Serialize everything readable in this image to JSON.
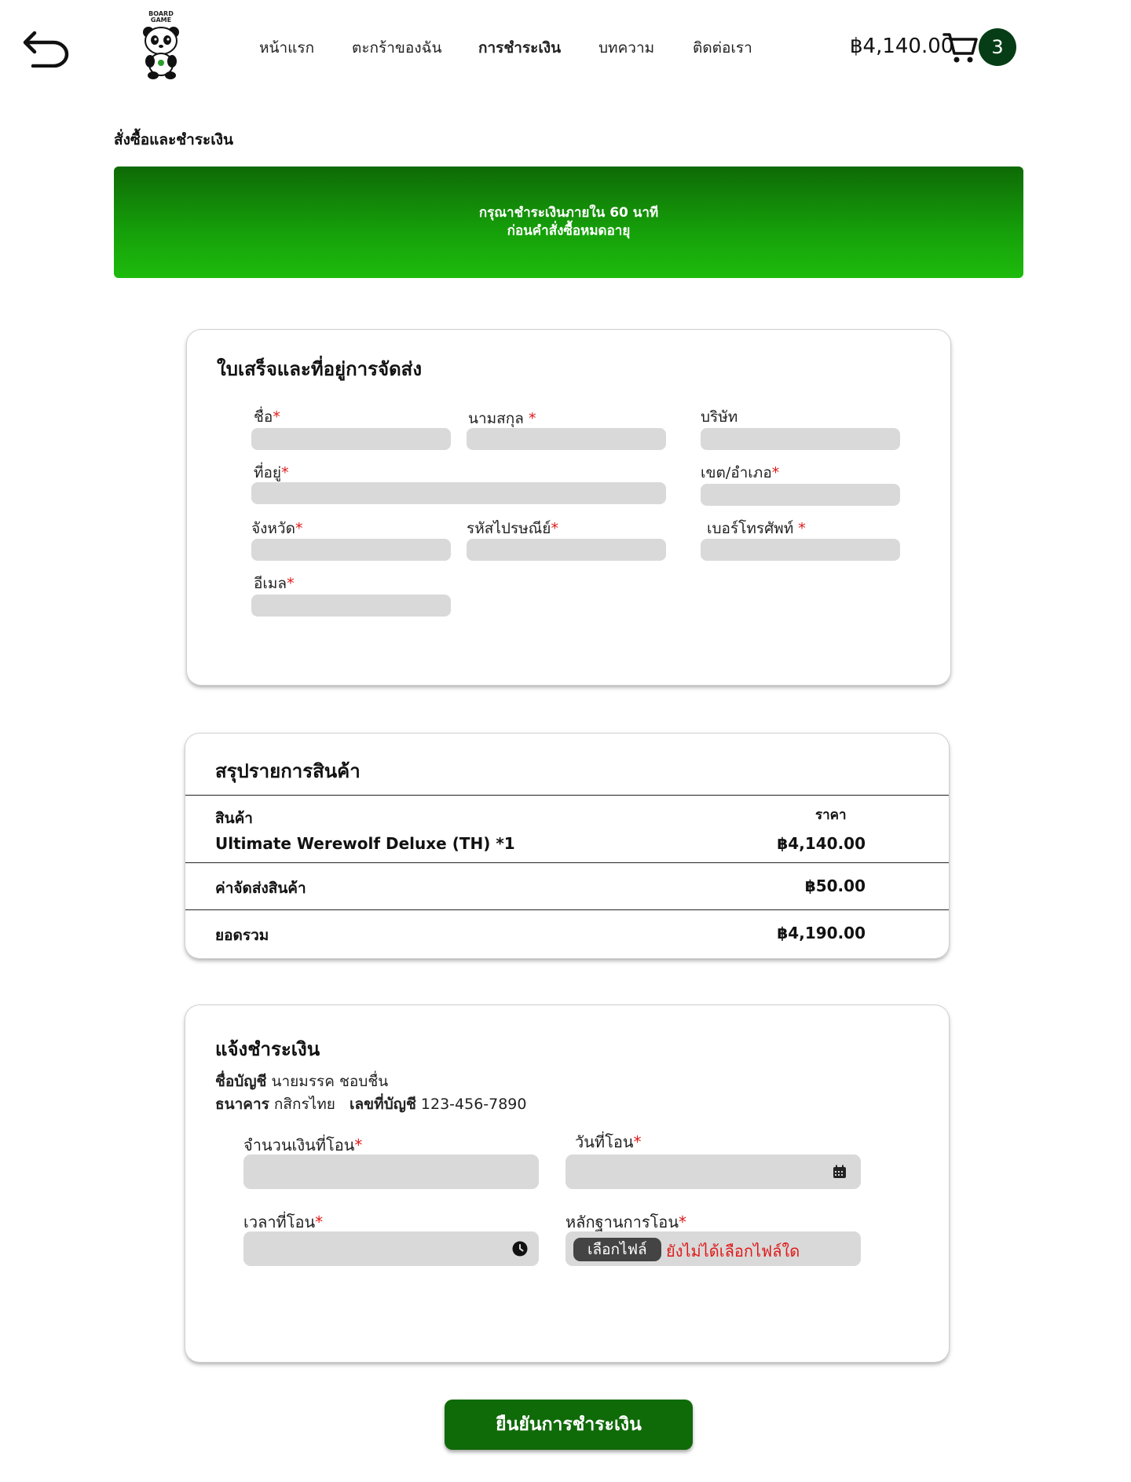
{
  "header": {
    "nav": [
      {
        "label": "หน้าแรก",
        "active": false
      },
      {
        "label": "ตะกร้าของฉัน",
        "active": false
      },
      {
        "label": "การชำระเงิน",
        "active": true
      },
      {
        "label": "บทความ",
        "active": false
      },
      {
        "label": "ติดต่อเรา",
        "active": false
      }
    ],
    "logo_text_1": "BOARD",
    "logo_text_2": "GAME",
    "cart_total": "฿4,140.00",
    "cart_count": "3"
  },
  "page_heading": "สั่งซื้อและชำระเงิน",
  "banner": {
    "line1": "กรุณาชำระเงินภายใน 60 นาที",
    "line2": "ก่อนคำสั่งซื้อหมดอายุ"
  },
  "billing": {
    "title": "ใบเสร็จและที่อยู่การจัดส่ง",
    "first_name": "ชื่อ",
    "last_name": "นามสกุล",
    "company": "บริษัท",
    "address": "ที่อยู่",
    "district": "เขต/อำเภอ",
    "province": "จังหวัด",
    "postal_code": "รหัสไปรษณีย์",
    "phone": "เบอร์โทรศัพท์",
    "email": "อีเมล",
    "required_mark": "*"
  },
  "summary": {
    "title": "สรุปรายการสินค้า",
    "col_product": "สินค้า",
    "col_price": "ราคา",
    "item_name": "Ultimate Werewolf Deluxe (TH) *1",
    "item_price": "฿4,140.00",
    "shipping_label": "ค่าจัดส่งสินค้า",
    "shipping_price": "฿50.00",
    "total_label": "ยอดรวม",
    "total_price": "฿4,190.00"
  },
  "payment": {
    "title": "แจ้งชำระเงิน",
    "account_name_label": "ชื่อบัญชี",
    "account_name": "นายมรรค ชอบชื่น",
    "bank_label": "ธนาคาร",
    "bank": "กสิกรไทย",
    "account_no_label": "เลขที่บัญชี",
    "account_no": "123-456-7890",
    "amount_label": "จำนวนเงินที่โอน",
    "date_label": "วันที่โอน",
    "time_label": "เวลาที่โอน",
    "proof_label": "หลักฐานการโอน",
    "file_button": "เลือกไฟล์",
    "file_status": "ยังไม่ได้เลือกไฟล์ใด"
  },
  "confirm_button": "ยืนยันการชำระเงิน",
  "colors": {
    "accent": "#0f6a08",
    "badge": "#063d16",
    "required": "#e01919",
    "input": "#d9d9d9"
  }
}
